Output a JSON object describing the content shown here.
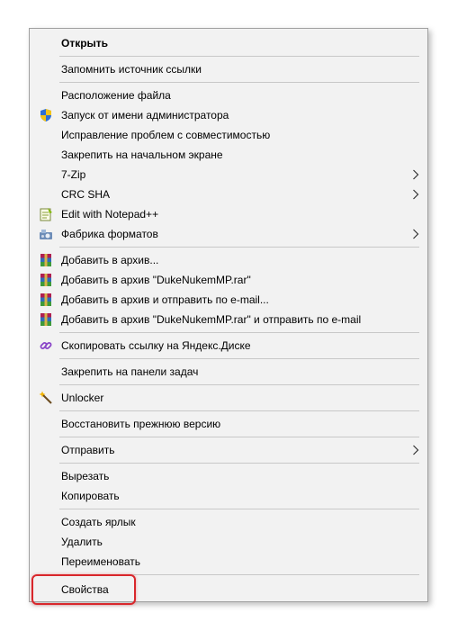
{
  "menu": {
    "open": "Открыть",
    "remember_source": "Запомнить источник ссылки",
    "file_location": "Расположение файла",
    "run_as_admin": "Запуск от имени администратора",
    "fix_compat": "Исправление проблем с совместимостью",
    "pin_start": "Закрепить на начальном экране",
    "seven_zip": "7-Zip",
    "crc_sha": "CRC SHA",
    "edit_notepad": "Edit with Notepad++",
    "format_factory": "Фабрика форматов",
    "add_archive": "Добавить в архив...",
    "add_archive_rar": "Добавить в архив \"DukeNukemMP.rar\"",
    "add_archive_email": "Добавить в архив и отправить по e-mail...",
    "add_archive_rar_email": "Добавить в архив \"DukeNukemMP.rar\" и отправить по e-mail",
    "copy_yandex_link": "Скопировать ссылку на Яндекс.Диске",
    "pin_taskbar": "Закрепить на панели задач",
    "unlocker": "Unlocker",
    "restore_version": "Восстановить прежнюю версию",
    "send_to": "Отправить",
    "cut": "Вырезать",
    "copy": "Копировать",
    "create_shortcut": "Создать ярлык",
    "delete": "Удалить",
    "rename": "Переименовать",
    "properties": "Свойства"
  },
  "icons": {
    "admin": "uac-shield-icon",
    "notepad": "notepad-plus-plus-icon",
    "format_factory": "format-factory-icon",
    "winrar": "winrar-icon",
    "yandex_link": "link-icon",
    "unlocker": "magic-wand-icon",
    "submenu_arrow": "chevron-right-icon"
  },
  "colors": {
    "highlight_border": "#d9262b",
    "menu_background": "#f2f2f2"
  }
}
